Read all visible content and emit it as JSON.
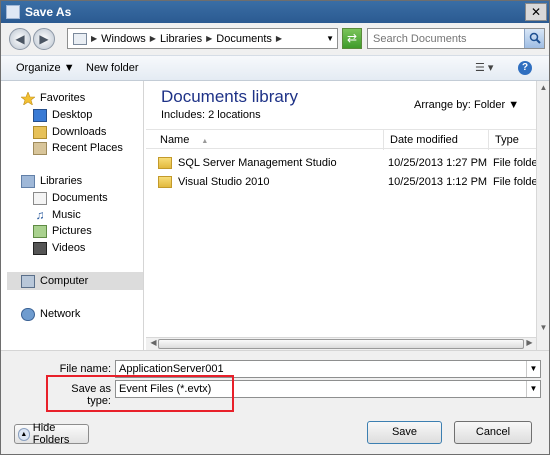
{
  "window": {
    "title": "Save As"
  },
  "address": {
    "crumbs": [
      "Windows",
      "Libraries",
      "Documents"
    ]
  },
  "search": {
    "placeholder": "Search Documents"
  },
  "toolbar": {
    "organize_label": "Organize ▼",
    "new_folder_label": "New folder"
  },
  "sidebar": {
    "favorites": {
      "label": "Favorites",
      "items": [
        "Desktop",
        "Downloads",
        "Recent Places"
      ]
    },
    "libraries": {
      "label": "Libraries",
      "items": [
        "Documents",
        "Music",
        "Pictures",
        "Videos"
      ]
    },
    "computer": "Computer",
    "network": "Network"
  },
  "library": {
    "title": "Documents library",
    "includes": "Includes: 2 locations",
    "arrange_by_label": "Arrange by:",
    "arrange_by_value": "Folder ▼"
  },
  "columns": {
    "name": "Name",
    "date": "Date modified",
    "type": "Type"
  },
  "files": [
    {
      "name": "SQL Server Management Studio",
      "date": "10/25/2013 1:27 PM",
      "type": "File folder"
    },
    {
      "name": "Visual Studio 2010",
      "date": "10/25/2013 1:12 PM",
      "type": "File folder"
    }
  ],
  "form": {
    "file_name_label": "File name:",
    "file_name_value": "ApplicationServer001",
    "save_type_label": "Save as type:",
    "save_type_value": "Event Files (*.evtx)"
  },
  "buttons": {
    "hide_folders": "Hide Folders",
    "save": "Save",
    "cancel": "Cancel"
  },
  "colors": {
    "highlight_box": "#e8202a",
    "library_title": "#1e3287"
  }
}
